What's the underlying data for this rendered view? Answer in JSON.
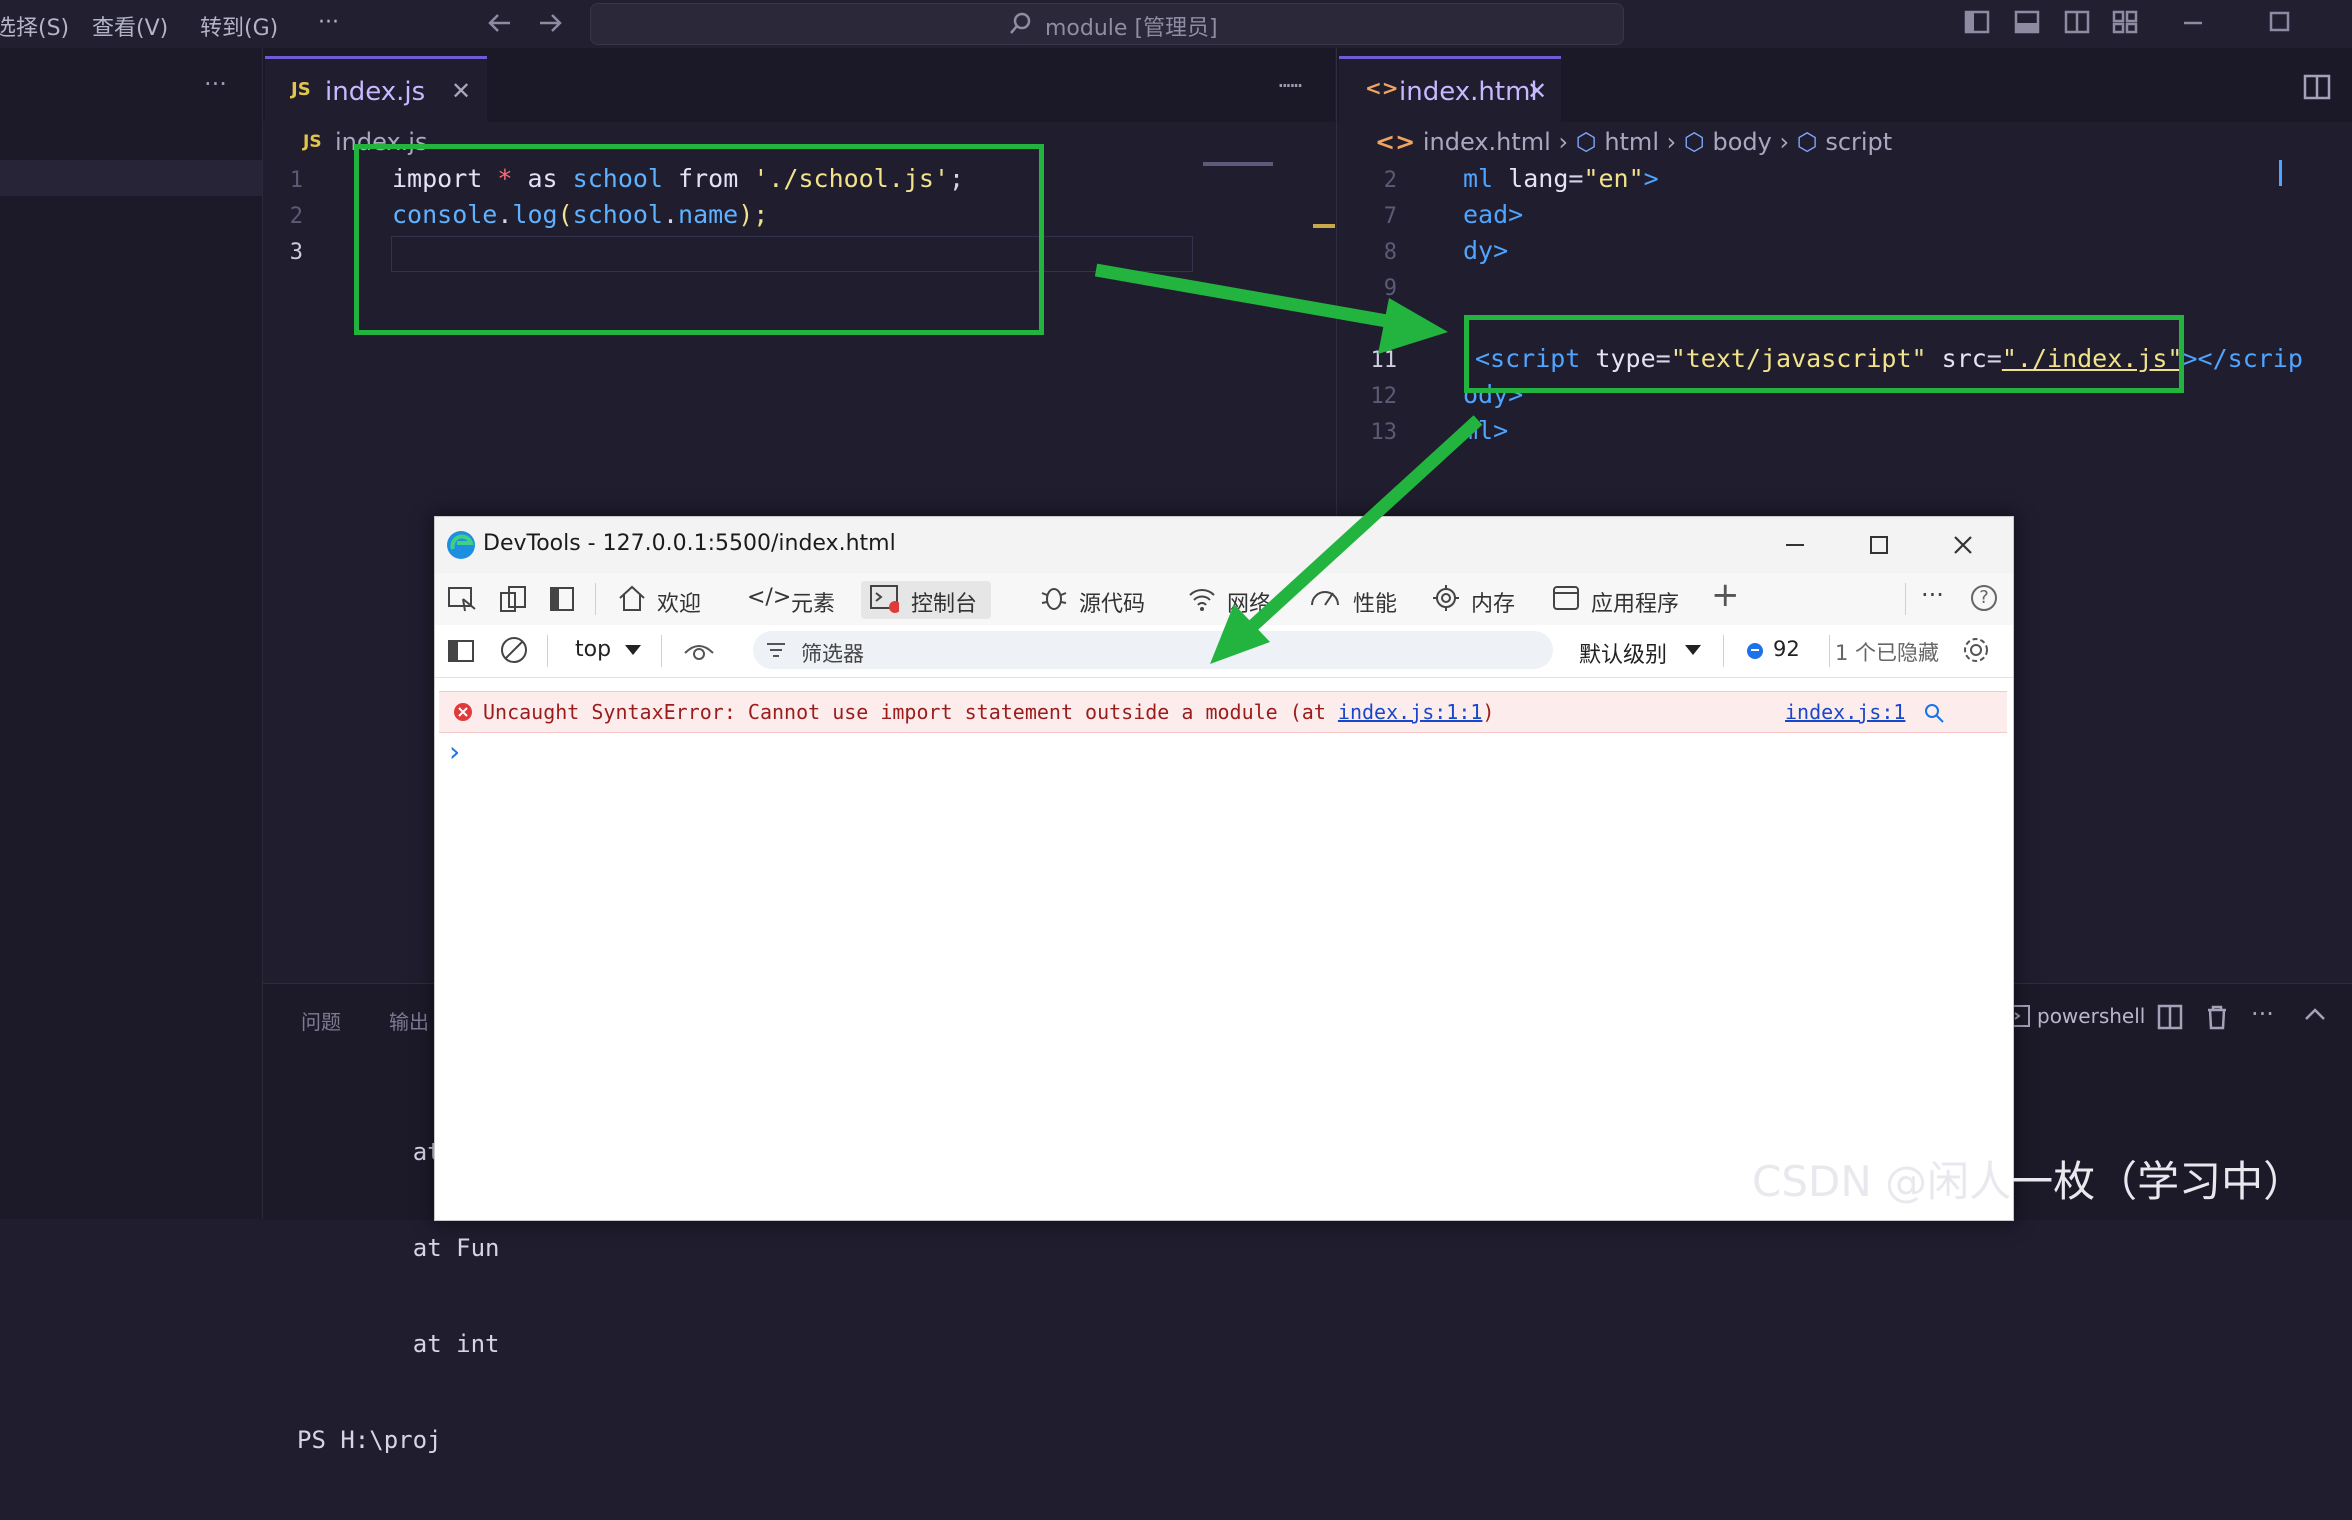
{
  "menubar": {
    "items": [
      "选择(S)",
      "查看(V)",
      "转到(G)",
      "···"
    ],
    "command_center": "module [管理员]"
  },
  "editor_left": {
    "more": "···",
    "tab": {
      "icon": "JS",
      "label": "index.js",
      "close": "✕"
    },
    "breadcrumb": "index.js",
    "line_numbers": [
      "1",
      "2",
      "3"
    ],
    "code": {
      "l1": {
        "a": "import",
        "b": "*",
        "c": "as",
        "d": "school",
        "e": "from",
        "f": "'./school.js'",
        "g": ";"
      },
      "l2": {
        "a": "console",
        "b": ".",
        "c": "log",
        "d": "(",
        "e": "school",
        "f": ".",
        "g": "name",
        "h": ");"
      }
    }
  },
  "editor_right": {
    "more": "···",
    "tab": {
      "icon": "<>",
      "label": "index.html",
      "close": "✕"
    },
    "breadcrumb": [
      "index.html",
      "html",
      "body",
      "script"
    ],
    "line_numbers": [
      "2",
      "7",
      "8",
      "9",
      "11",
      "12",
      "13"
    ],
    "code": {
      "l2": {
        "a": "ml",
        "b": "lang",
        "c": "=",
        "d": "\"en\"",
        "e": ">"
      },
      "l7": {
        "a": "ead",
        "b": ">"
      },
      "l8": {
        "a": "dy",
        "b": ">"
      },
      "l11": {
        "a": "<script",
        "b": "type",
        "c": "=",
        "d": "\"text/javascript\"",
        "e": "src",
        "f": "\"./index.js\"",
        "g": "></scrip"
      },
      "l12": {
        "a": "ody",
        "b": ">"
      },
      "l13": {
        "a": "ml",
        "b": ">"
      }
    }
  },
  "panel": {
    "tabs": [
      "问题",
      "输出"
    ],
    "terminal_lines": [
      "    at Fun",
      "    at Fun",
      "    at int",
      "PS H:\\proj"
    ],
    "shell": "powershell",
    "more": "···"
  },
  "devtools": {
    "title": "DevTools - 127.0.0.1:5500/index.html",
    "tabs": [
      "欢迎",
      "元素",
      "控制台",
      "源代码",
      "网络",
      "性能",
      "内存",
      "应用程序"
    ],
    "add": "+",
    "more": "···",
    "help": "?",
    "context": "top",
    "filter_placeholder": "筛选器",
    "level": "默认级别",
    "issue_count": "92",
    "hidden": "1 个已隐藏",
    "error": {
      "message": "Uncaught SyntaxError: Cannot use import statement outside a module (at ",
      "link": "index.js:1:1",
      "tail": ")",
      "source": "index.js:1"
    },
    "prompt": "›"
  },
  "watermark": "CSDN @闲人一枚（学习中）",
  "colors": {
    "highlight_box": "#22b43e",
    "arrow": "#22b43e",
    "error_bg": "#fdecec",
    "accent": "#6e5bd6"
  }
}
